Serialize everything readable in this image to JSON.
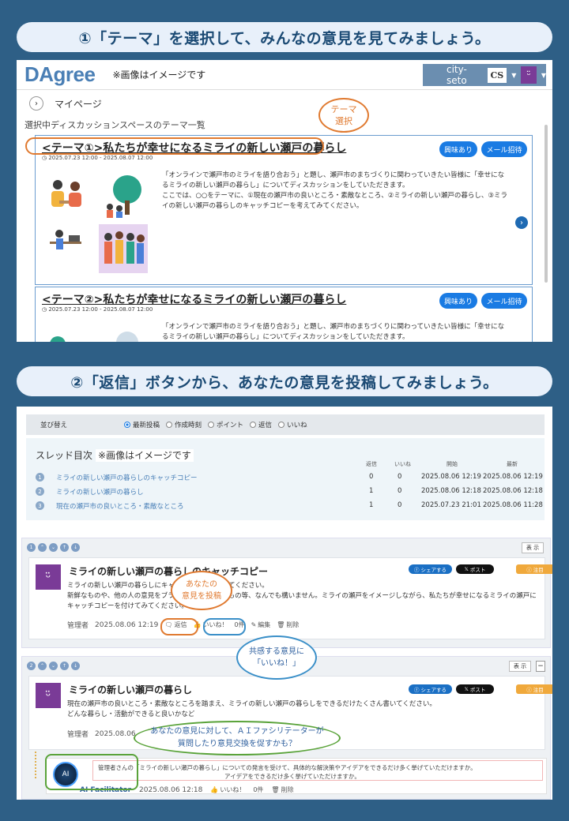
{
  "step1": {
    "title": "①「テーマ」を選択して、みんなの意見を見てみましょう。"
  },
  "step2": {
    "title": "②「返信」ボタンから、あなたの意見を投稿してみましょう。"
  },
  "app": {
    "logo": "DAgree",
    "image_note": "※画像はイメージです",
    "user_name": "city-seto",
    "user_badge": "CS",
    "breadcrumb": "マイページ",
    "list_heading": "選択中ディスカッションスペースのテーマ一覧"
  },
  "themes": [
    {
      "title": "<テーマ①>私たちが幸せになるミライの新しい瀬戸の暮らし",
      "date": "2025.07.23 12:00 - 2025.08.07 12:00",
      "interest_label": "興味あり",
      "invite_label": "メール招待",
      "description": "「オンラインで瀬戸市のミライを語り合おう」と題し、瀬戸市のまちづくりに関わっていきたい皆様に「幸せになるミライの新しい瀬戸の暮らし」についてディスカッションをしていただきます。\nここでは、○○をテーマに、①現在の瀬戸市の良いところ・素敵なところ、②ミライの新しい瀬戸の暮らし、③ミライの新しい瀬戸の暮らしのキャッチコピーを考えてみてください。"
    },
    {
      "title": "<テーマ②>私たちが幸せになるミライの新しい瀬戸の暮らし",
      "date": "2025.07.23 12:00 - 2025.08.07 12:00",
      "interest_label": "興味あり",
      "invite_label": "メール招待",
      "description": "「オンラインで瀬戸市のミライを語り合おう」と題し、瀬戸市のまちづくりに関わっていきたい皆様に「幸せになるミライの新しい瀬戸の暮らし」についてディスカッションをしていただきます。"
    }
  ],
  "callout_theme": "テーマ\n選択",
  "sort": {
    "label": "並び替え",
    "options": [
      "最新投稿",
      "作成時刻",
      "ポイント",
      "返信",
      "いいね"
    ],
    "selected": "最新投稿"
  },
  "toc": {
    "heading": "スレッド目次",
    "note": "※画像はイメージです",
    "columns": [
      "返信",
      "いいね",
      "開始",
      "最新"
    ],
    "rows": [
      {
        "num": "1",
        "title": "ミライの新しい瀬戸の暮らしのキャッチコピー",
        "replies": "0",
        "likes": "0",
        "start": "2025.08.06 12:19",
        "latest": "2025.08.06 12:19"
      },
      {
        "num": "2",
        "title": "ミライの新しい瀬戸の暮らし",
        "replies": "1",
        "likes": "0",
        "start": "2025.08.06 12:18",
        "latest": "2025.08.06 12:18"
      },
      {
        "num": "3",
        "title": "現在の瀬戸市の良いところ・素敵なところ",
        "replies": "1",
        "likes": "0",
        "start": "2025.07.23 21:01",
        "latest": "2025.08.06 11:28"
      }
    ]
  },
  "thread1": {
    "show_label": "表 示",
    "title": "ミライの新しい瀬戸の暮らしのキャッチコピー",
    "body": "ミライの新しい瀬戸の暮らしにキャッチコピーを付けてください。\n新鮮なものや、他の人の意見をブラッシュアップしたもの等、なんでも構いません。ミライの瀬戸をイメージしながら、私たちが幸せになるミライの瀬戸にキャッチコピーを付けてみてください。",
    "author": "管理者",
    "time": "2025.08.06 12:19",
    "reply_label": "返信",
    "like_label": "いいね！",
    "like_count": "0件",
    "edit_label": "編集",
    "delete_label": "削除",
    "share_label": "シェアする",
    "post_label": "ポスト",
    "notice_label": "注目"
  },
  "thread2": {
    "show_label": "表 示",
    "title": "ミライの新しい瀬戸の暮らし",
    "body": "現在の瀬戸市の良いところ・素敵なところを踏まえ、ミライの新しい瀬戸の暮らしをできるだけたくさん書いてください。\nどんな暮らし・活動ができると良いかなど",
    "author": "管理者",
    "time": "2025.08.06",
    "share_label": "シェアする",
    "post_label": "ポスト",
    "notice_label": "注目",
    "reply": {
      "avatar_text": "AI",
      "author": "AI Facilitator",
      "time": "2025.08.06 12:18",
      "text_line1": "管理者さんの「ミライの新しい瀬戸の暮らし」についての発言を受けて、具体的な解決策やアイデアをできるだけ多く挙げていただけますか。",
      "text_line2": "アイデアをできるだけ多く挙げていただけますか。",
      "like_label": "いいね！",
      "like_count": "0件",
      "delete_label": "削除"
    }
  },
  "callouts": {
    "post_opinion": "あなたの\n意見を投稿",
    "like": "共感する意見に\n「いいね！」",
    "ai": "あなたの意見に対して、ＡＩファシリテーターが\n質問したり意見交換を促すかも？"
  },
  "colors": {
    "background": "#2e5f86",
    "accent_orange": "#e07a30",
    "accent_green": "#5aa33a",
    "accent_blue": "#3a8fc8",
    "brand_purple": "#7a3b97"
  }
}
